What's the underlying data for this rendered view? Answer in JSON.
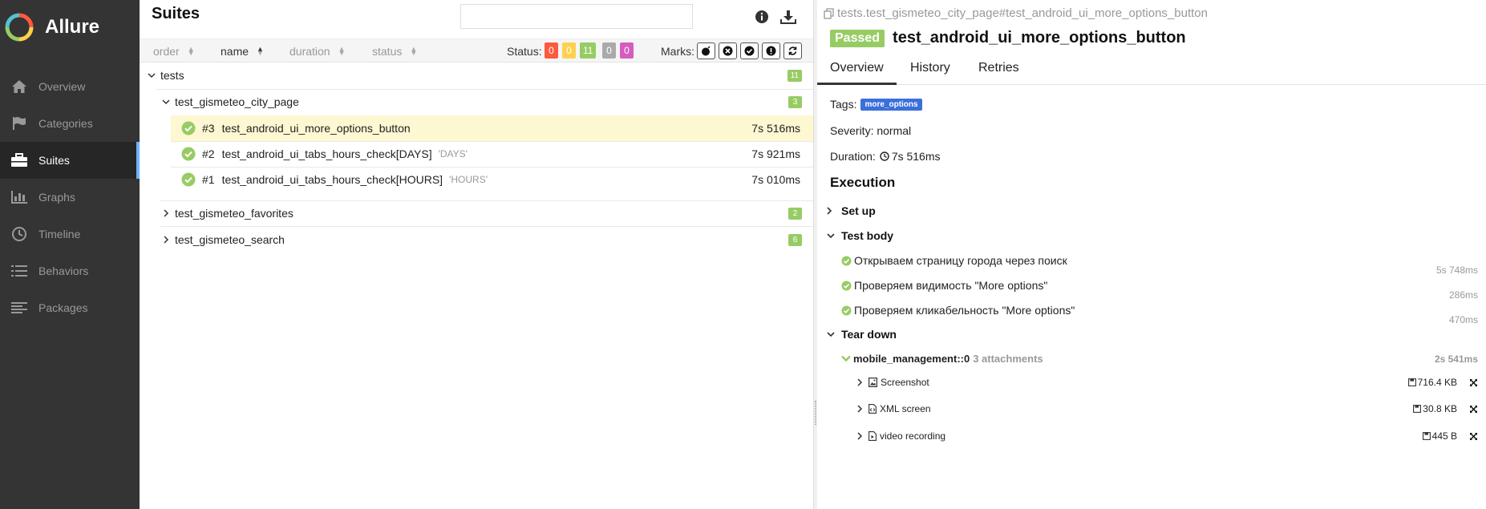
{
  "app": {
    "name": "Allure"
  },
  "sidebar": {
    "items": [
      {
        "label": "Overview",
        "icon": "home-icon"
      },
      {
        "label": "Categories",
        "icon": "flag-icon"
      },
      {
        "label": "Suites",
        "icon": "briefcase-icon",
        "active": true
      },
      {
        "label": "Graphs",
        "icon": "bar-chart-icon"
      },
      {
        "label": "Timeline",
        "icon": "clock-icon"
      },
      {
        "label": "Behaviors",
        "icon": "list-icon"
      },
      {
        "label": "Packages",
        "icon": "align-left-icon"
      }
    ]
  },
  "suites": {
    "title": "Suites",
    "search_value": "",
    "sort": {
      "order": "order",
      "name": "name",
      "duration": "duration",
      "status": "status"
    },
    "status_label": "Status:",
    "status_counts": [
      {
        "value": "0",
        "color": "#fd5a3e"
      },
      {
        "value": "0",
        "color": "#ffd050"
      },
      {
        "value": "11",
        "color": "#97cc64"
      },
      {
        "value": "0",
        "color": "#aaaaaa"
      },
      {
        "value": "0",
        "color": "#d35ebe"
      }
    ],
    "marks_label": "Marks:",
    "tree": {
      "root": {
        "name": "tests",
        "count": "11"
      },
      "groups": [
        {
          "name": "test_gismeteo_city_page",
          "count": "3",
          "cases": [
            {
              "num": "#3",
              "name": "test_android_ui_more_options_button",
              "param": "",
              "duration": "7s 516ms"
            },
            {
              "num": "#2",
              "name": "test_android_ui_tabs_hours_check[DAYS]",
              "param": "'DAYS'",
              "duration": "7s 921ms"
            },
            {
              "num": "#1",
              "name": "test_android_ui_tabs_hours_check[HOURS]",
              "param": "'HOURS'",
              "duration": "7s 010ms"
            }
          ]
        },
        {
          "name": "test_gismeteo_favorites",
          "count": "2"
        },
        {
          "name": "test_gismeteo_search",
          "count": "6"
        }
      ]
    }
  },
  "detail": {
    "breadcrumb": "tests.test_gismeteo_city_page#test_android_ui_more_options_button",
    "status": "Passed",
    "status_color": "#97cc64",
    "title": "test_android_ui_more_options_button",
    "tabs": [
      "Overview",
      "History",
      "Retries"
    ],
    "tags_label": "Tags:",
    "tag": "more_options",
    "severity": "Severity: normal",
    "duration_label": "Duration:",
    "duration": "7s 516ms",
    "execution_title": "Execution",
    "setup_label": "Set up",
    "body_label": "Test body",
    "steps": [
      {
        "name": "Открываем страницу города через поиск",
        "duration": "5s 748ms"
      },
      {
        "name": "Проверяем видимость \"More options\"",
        "duration": "286ms"
      },
      {
        "name": "Проверяем кликабельность \"More options\"",
        "duration": "470ms"
      }
    ],
    "teardown_label": "Tear down",
    "teardown": {
      "name": "mobile_management::0",
      "attachments_text": "3 attachments",
      "duration": "2s 541ms",
      "attachments": [
        {
          "name": "Screenshot",
          "size": "716.4 KB",
          "icon": "image-file-icon"
        },
        {
          "name": "XML screen",
          "size": "30.8 KB",
          "icon": "code-file-icon"
        },
        {
          "name": "video recording",
          "size": "445 B",
          "icon": "video-file-icon"
        }
      ]
    }
  }
}
